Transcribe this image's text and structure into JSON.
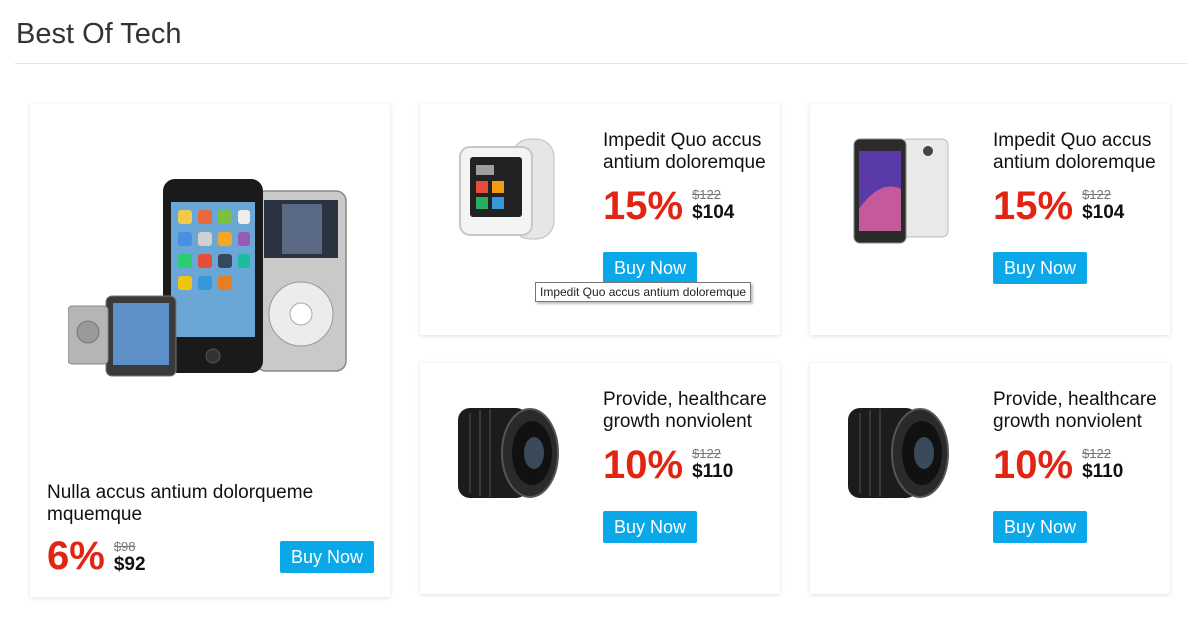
{
  "section": {
    "title": "Best Of Tech"
  },
  "featured": {
    "title": "Nulla accus antium dolorqueme mquemque",
    "discount": "6%",
    "old_price": "$98",
    "new_price": "$92",
    "button": "Buy Now",
    "icon": "ipod-family-image"
  },
  "products": [
    {
      "title": "Impedit Quo accus antium doloremque",
      "discount": "15%",
      "old_price": "$122",
      "new_price": "$104",
      "button": "Buy Now",
      "icon": "smartwatch-image"
    },
    {
      "title": "Impedit Quo accus antium doloremque",
      "discount": "15%",
      "old_price": "$122",
      "new_price": "$104",
      "button": "Buy Now",
      "icon": "smartphone-image"
    },
    {
      "title": "Provide, healthcare growth nonviolent",
      "discount": "10%",
      "old_price": "$122",
      "new_price": "$110",
      "button": "Buy Now",
      "icon": "camera-lens-image"
    },
    {
      "title": "Provide, healthcare growth nonviolent",
      "discount": "10%",
      "old_price": "$122",
      "new_price": "$110",
      "button": "Buy Now",
      "icon": "camera-lens-image"
    }
  ],
  "tooltip": {
    "text": "Impedit Quo accus antium doloremque"
  },
  "colors": {
    "accent": "#0aa8e8",
    "discount": "#e22413"
  }
}
